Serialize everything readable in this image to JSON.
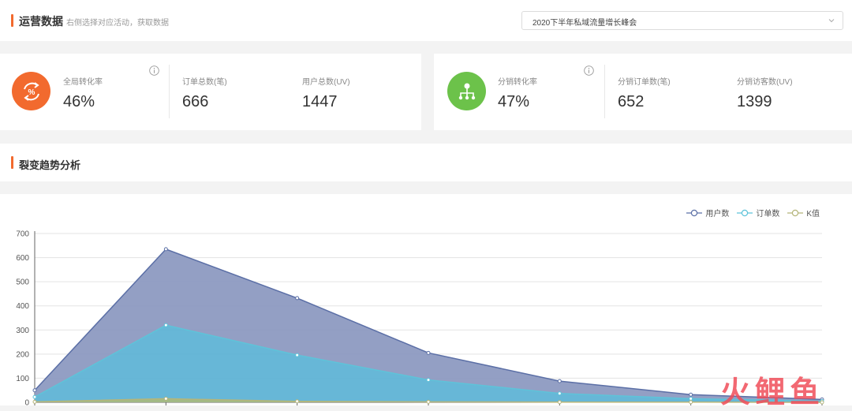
{
  "header": {
    "title": "运营数据",
    "hint": "右侧选择对应活动，获取数据",
    "activity_select": {
      "value": "2020下半年私域流量增长峰会"
    }
  },
  "stats_left": {
    "icon": "percent-cycle-icon",
    "icon_color": "#f26a2e",
    "items": [
      {
        "label": "全局转化率",
        "value": "46%"
      },
      {
        "label": "订单总数(笔)",
        "value": "666"
      },
      {
        "label": "用户总数(UV)",
        "value": "1447"
      }
    ]
  },
  "stats_right": {
    "icon": "share-tree-icon",
    "icon_color": "#6cc24a",
    "items": [
      {
        "label": "分销转化率",
        "value": "47%"
      },
      {
        "label": "分销订单数(笔)",
        "value": "652"
      },
      {
        "label": "分销访客数(UV)",
        "value": "1399"
      }
    ]
  },
  "section": {
    "title": "裂变趋势分析"
  },
  "watermark": "火鲤鱼",
  "chart_data": {
    "type": "area",
    "x_count": 7,
    "ylim": [
      0,
      700
    ],
    "yticks": [
      0,
      100,
      200,
      300,
      400,
      500,
      600,
      700
    ],
    "grid": true,
    "legend_position": "top-right",
    "series": [
      {
        "name": "用户数",
        "color": "#5b6fa6",
        "fill": "#8a97bf",
        "values": [
          50,
          635,
          432,
          205,
          88,
          32,
          12
        ]
      },
      {
        "name": "订单数",
        "color": "#5ec3d9",
        "fill": "#63b9d8",
        "values": [
          22,
          320,
          196,
          93,
          37,
          15,
          5
        ]
      },
      {
        "name": "K值",
        "color": "#b5b57a",
        "fill": "#a7b87e",
        "values": [
          2,
          15,
          4,
          2,
          1,
          1,
          0
        ]
      }
    ]
  }
}
